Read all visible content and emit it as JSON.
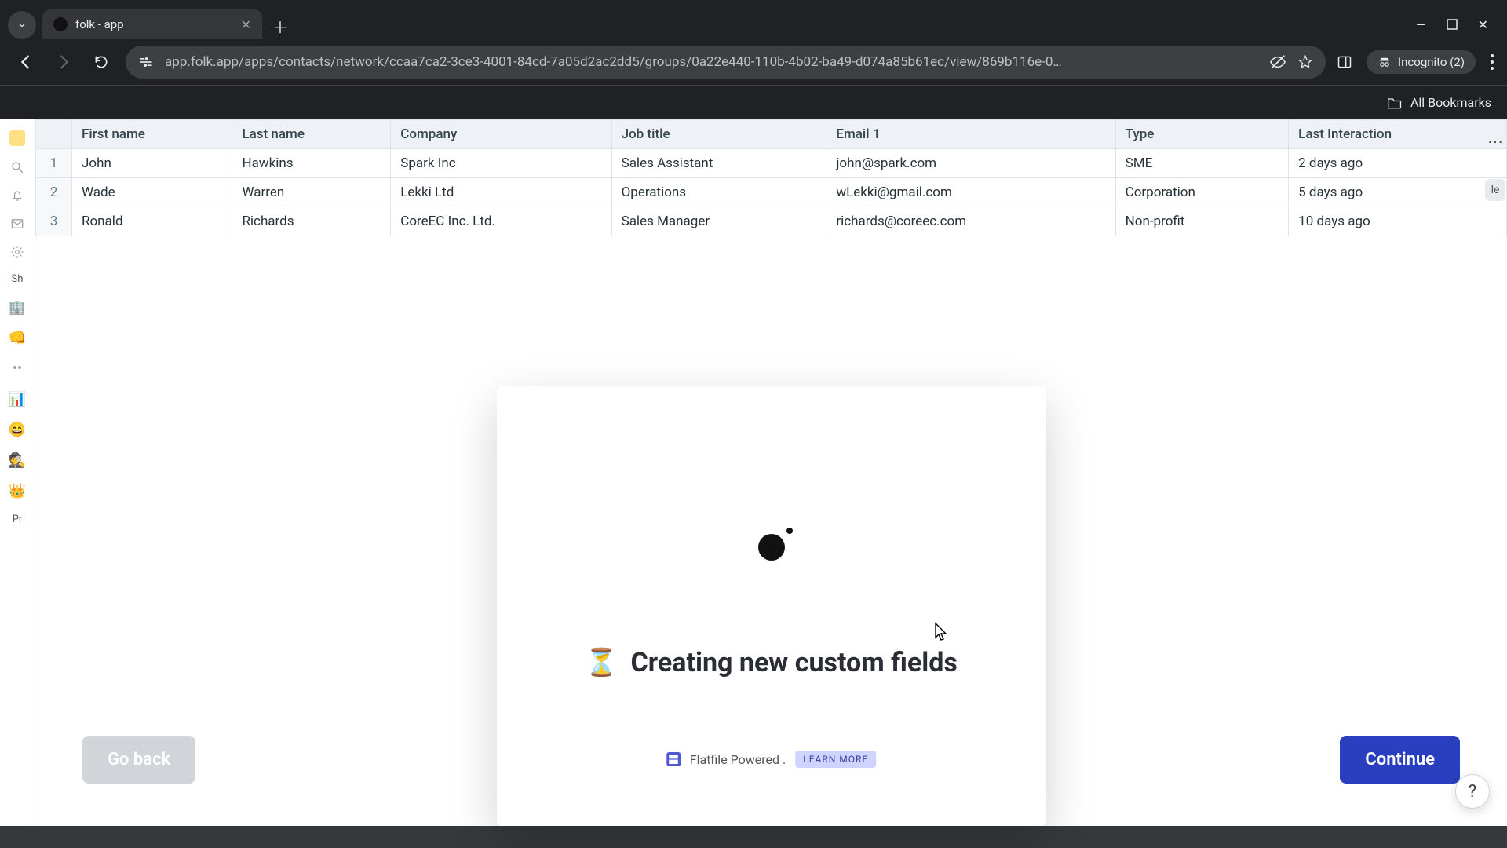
{
  "browser": {
    "tab_title": "folk - app",
    "url_display": "app.folk.app/apps/contacts/network/ccaa7ca2-3ce3-4001-84cd-7a05d2ac2dd5/groups/0a22e440-110b-4b02-ba49-d074a85b61ec/view/869b116e-0…",
    "incognito_label": "Incognito (2)",
    "bookmarks_label": "All Bookmarks"
  },
  "sidebar": {
    "shared_label": "Sh",
    "private_label": "Pr"
  },
  "right_edge": {
    "pill_label": "le"
  },
  "table": {
    "columns": [
      "First name",
      "Last name",
      "Company",
      "Job title",
      "Email 1",
      "Type",
      "Last Interaction"
    ],
    "rows": [
      {
        "n": "1",
        "first": "John",
        "last": "Hawkins",
        "company": "Spark Inc",
        "job": "Sales Assistant",
        "email": "john@spark.com",
        "type": "SME",
        "last_interaction": "2 days ago"
      },
      {
        "n": "2",
        "first": "Wade",
        "last": "Warren",
        "company": "Lekki Ltd",
        "job": "Operations",
        "email": "wLekki@gmail.com",
        "type": "Corporation",
        "last_interaction": "5 days ago"
      },
      {
        "n": "3",
        "first": "Ronald",
        "last": "Richards",
        "company": "CoreEC Inc. Ltd.",
        "job": "Sales Manager",
        "email": "richards@coreec.com",
        "type": "Non-profit",
        "last_interaction": "10 days ago"
      }
    ]
  },
  "overlay": {
    "title": "Creating new custom fields"
  },
  "footer": {
    "back": "Go back",
    "continue": "Continue",
    "flatfile": "Flatfile Powered .",
    "learn": "LEARN MORE"
  },
  "help": {
    "label": "?"
  }
}
